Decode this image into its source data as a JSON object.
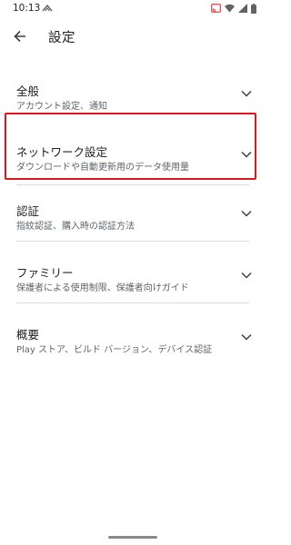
{
  "status_bar": {
    "time": "10:13",
    "icons": [
      "sync-icon",
      "cast-icon",
      "wifi-icon",
      "signal-icon",
      "battery-icon"
    ]
  },
  "app_bar": {
    "title": "設定",
    "back_icon": "arrow-back-icon"
  },
  "settings": {
    "items": [
      {
        "title": "全般",
        "subtitle": "アカウント設定、通知",
        "icon": "chevron-down-icon",
        "highlighted": false
      },
      {
        "title": "ネットワーク設定",
        "subtitle": "ダウンロードや自動更新用のデータ使用量",
        "icon": "chevron-down-icon",
        "highlighted": true
      },
      {
        "title": "認証",
        "subtitle": "指紋認証、購入時の認証方法",
        "icon": "chevron-down-icon",
        "highlighted": false
      },
      {
        "title": "ファミリー",
        "subtitle": "保護者による使用制限、保護者向けガイド",
        "icon": "chevron-down-icon",
        "highlighted": false
      },
      {
        "title": "概要",
        "subtitle": "Play ストア、ビルド バージョン、デバイス認証",
        "icon": "chevron-down-icon",
        "highlighted": false
      }
    ]
  },
  "colors": {
    "highlight": "#e0161d",
    "text_primary": "#202124",
    "text_secondary": "#5f6368",
    "divider": "#dadce0"
  }
}
